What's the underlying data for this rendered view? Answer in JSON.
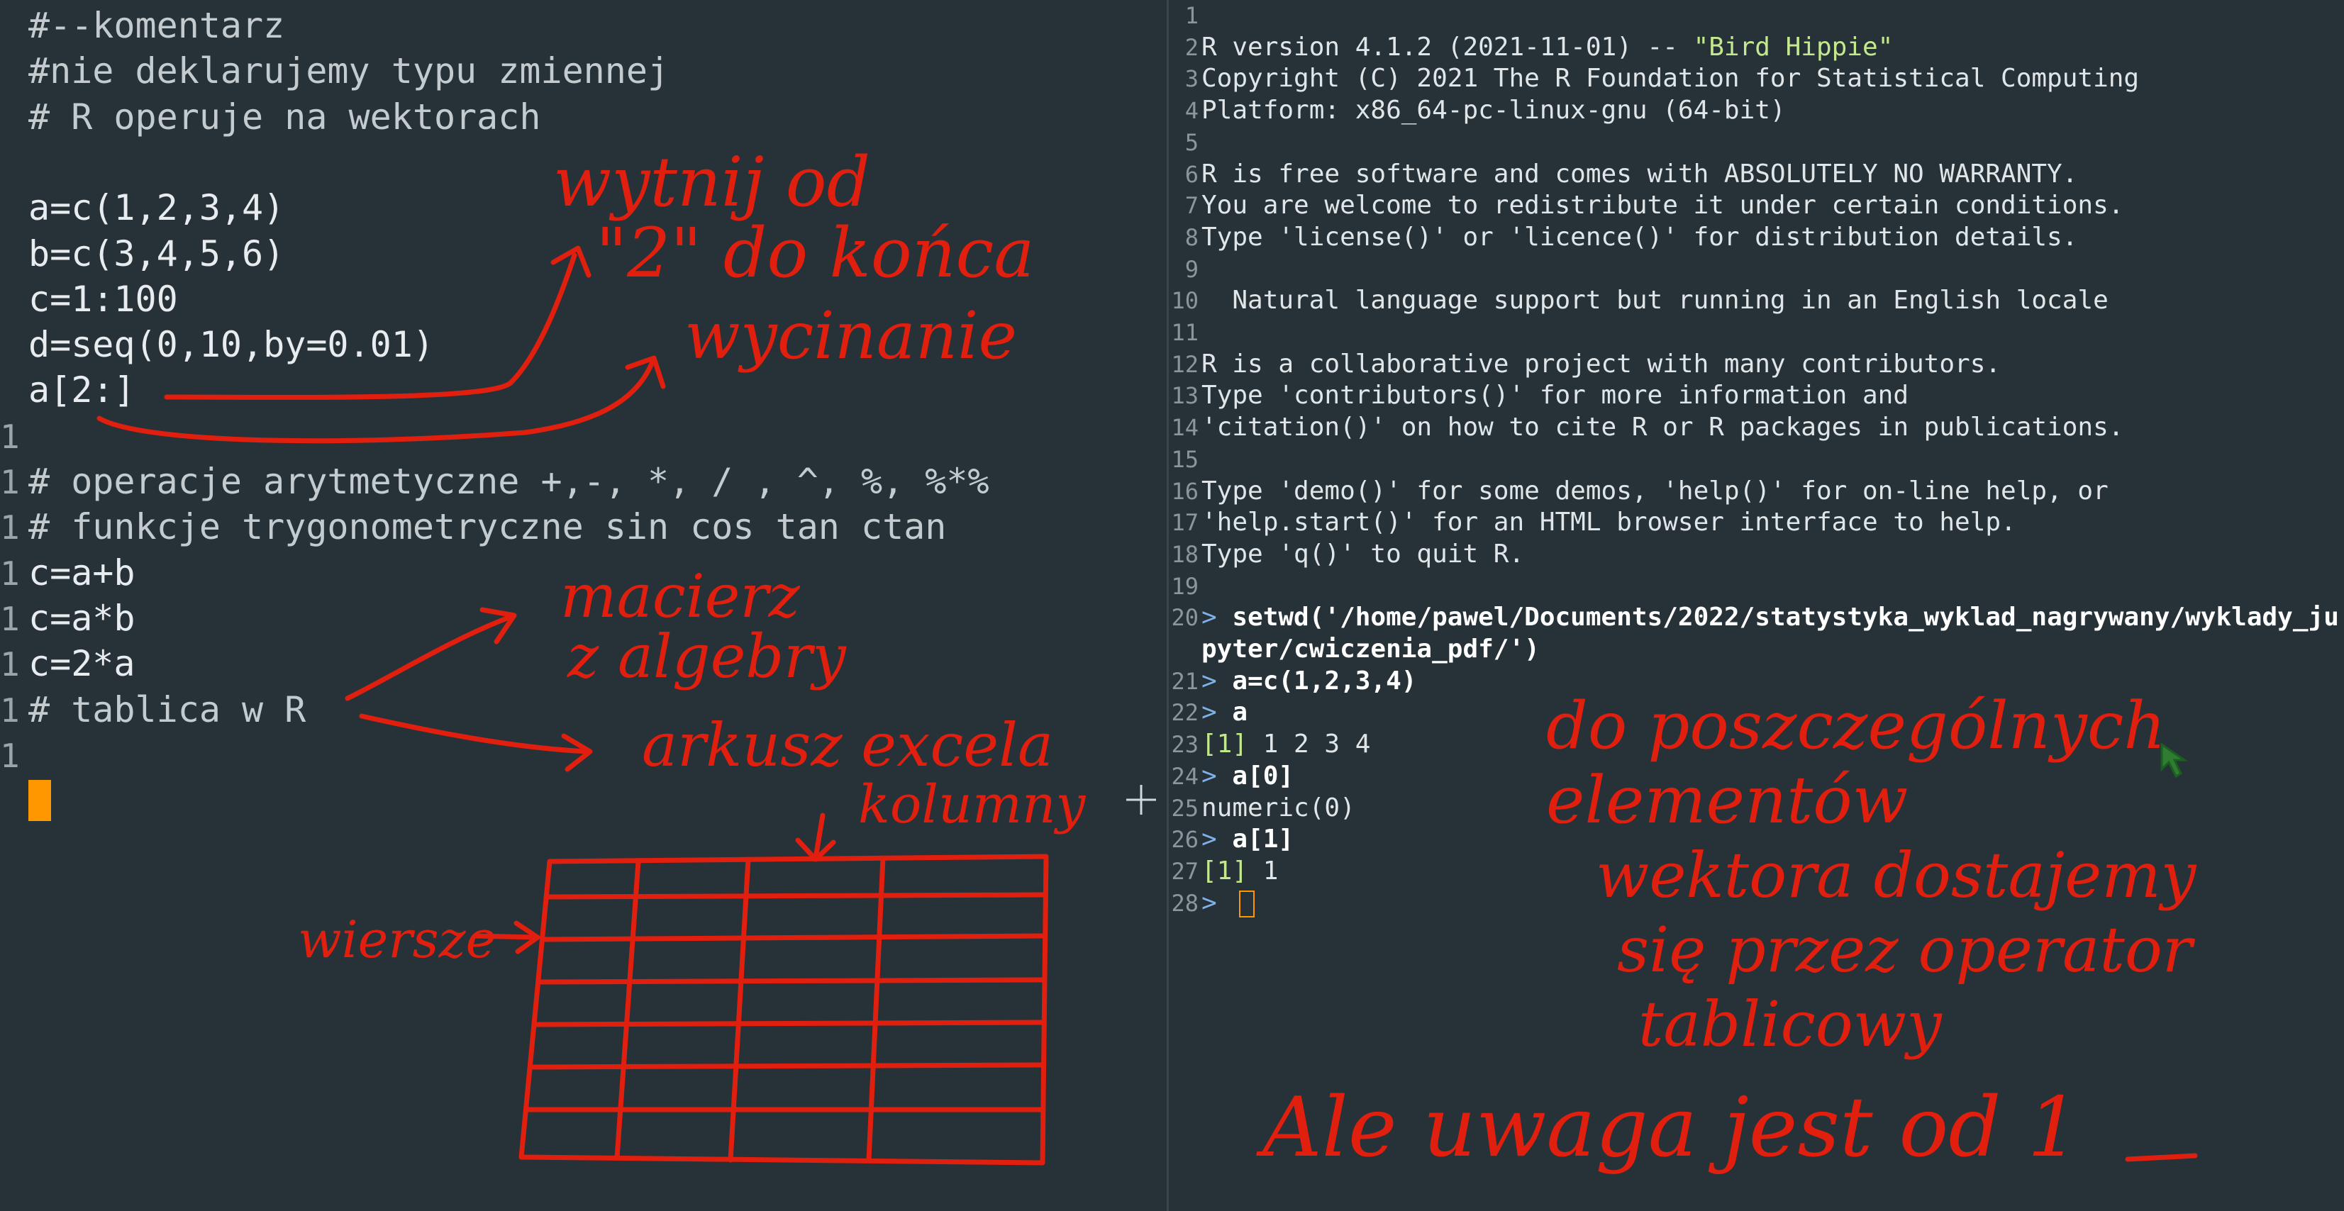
{
  "editor": {
    "lines": [
      {
        "gutter": "",
        "text": "#--komentarz",
        "comment": true
      },
      {
        "gutter": "",
        "text": "#nie deklarujemy typu zmiennej",
        "comment": true
      },
      {
        "gutter": "",
        "text": "# R operuje na wektorach",
        "comment": true
      },
      {
        "gutter": "",
        "text": "",
        "comment": false
      },
      {
        "gutter": "",
        "text": "a=c(1,2,3,4)",
        "comment": false
      },
      {
        "gutter": "",
        "text": "b=c(3,4,5,6)",
        "comment": false
      },
      {
        "gutter": "",
        "text": "c=1:100",
        "comment": false
      },
      {
        "gutter": "",
        "text": "d=seq(0,10,by=0.01)",
        "comment": false
      },
      {
        "gutter": "",
        "text": "a[2:]",
        "comment": false
      },
      {
        "gutter": "1",
        "text": "",
        "comment": false
      },
      {
        "gutter": "1",
        "text": "# operacje arytmetyczne +,-, *, / , ^, %, %*%",
        "comment": true
      },
      {
        "gutter": "1",
        "text": "# funkcje trygonometryczne sin cos tan ctan",
        "comment": true
      },
      {
        "gutter": "1",
        "text": "c=a+b",
        "comment": false
      },
      {
        "gutter": "1",
        "text": "c=a*b",
        "comment": false
      },
      {
        "gutter": "1",
        "text": "c=2*a",
        "comment": false
      },
      {
        "gutter": "1",
        "text": "# tablica w R",
        "comment": true
      },
      {
        "gutter": "1",
        "text": "",
        "comment": false
      }
    ]
  },
  "console": {
    "lines": [
      {
        "gutter": "1",
        "parts": [
          {
            "t": "",
            "c": ""
          }
        ]
      },
      {
        "gutter": "2",
        "parts": [
          {
            "t": "R version 4.1.2 (2021-11-01) -- ",
            "c": ""
          },
          {
            "t": "\"Bird Hippie\"",
            "c": "str"
          }
        ]
      },
      {
        "gutter": "3",
        "parts": [
          {
            "t": "Copyright (C) 2021 The R Foundation for Statistical Computing",
            "c": ""
          }
        ]
      },
      {
        "gutter": "4",
        "parts": [
          {
            "t": "Platform: x86_64-pc-linux-gnu (64-bit)",
            "c": ""
          }
        ]
      },
      {
        "gutter": "5",
        "parts": [
          {
            "t": "",
            "c": ""
          }
        ]
      },
      {
        "gutter": "6",
        "parts": [
          {
            "t": "R is free software and comes with ABSOLUTELY NO WARRANTY.",
            "c": ""
          }
        ]
      },
      {
        "gutter": "7",
        "parts": [
          {
            "t": "You are welcome to redistribute it under certain conditions.",
            "c": ""
          }
        ]
      },
      {
        "gutter": "8",
        "parts": [
          {
            "t": "Type 'license()' or 'licence()' for distribution details.",
            "c": ""
          }
        ]
      },
      {
        "gutter": "9",
        "parts": [
          {
            "t": "",
            "c": ""
          }
        ]
      },
      {
        "gutter": "10",
        "parts": [
          {
            "t": "  Natural language support but running in an English locale",
            "c": ""
          }
        ]
      },
      {
        "gutter": "11",
        "parts": [
          {
            "t": "",
            "c": ""
          }
        ]
      },
      {
        "gutter": "12",
        "parts": [
          {
            "t": "R is a collaborative project with many contributors.",
            "c": ""
          }
        ]
      },
      {
        "gutter": "13",
        "parts": [
          {
            "t": "Type 'contributors()' for more information and",
            "c": ""
          }
        ]
      },
      {
        "gutter": "14",
        "parts": [
          {
            "t": "'citation()' on how to cite R or R packages in publications.",
            "c": ""
          }
        ]
      },
      {
        "gutter": "15",
        "parts": [
          {
            "t": "",
            "c": ""
          }
        ]
      },
      {
        "gutter": "16",
        "parts": [
          {
            "t": "Type 'demo()' for some demos, 'help()' for on-line help, or",
            "c": ""
          }
        ]
      },
      {
        "gutter": "17",
        "parts": [
          {
            "t": "'help.start()' for an HTML browser interface to help.",
            "c": ""
          }
        ]
      },
      {
        "gutter": "18",
        "parts": [
          {
            "t": "Type 'q()' to quit R.",
            "c": ""
          }
        ]
      },
      {
        "gutter": "19",
        "parts": [
          {
            "t": "",
            "c": ""
          }
        ]
      },
      {
        "gutter": "20",
        "parts": [
          {
            "t": "> ",
            "c": "prompt"
          },
          {
            "t": "setwd('/home/pawel/Documents/2022/statystyka_wyklad_nagrywany/wyklady_ju",
            "c": "cmd"
          }
        ]
      },
      {
        "gutter": "",
        "parts": [
          {
            "t": "pyter/cwiczenia_pdf/')",
            "c": "cmd"
          }
        ]
      },
      {
        "gutter": "21",
        "parts": [
          {
            "t": "> ",
            "c": "prompt"
          },
          {
            "t": "a=c(1,2,3,4)",
            "c": "cmd"
          }
        ]
      },
      {
        "gutter": "22",
        "parts": [
          {
            "t": "> ",
            "c": "prompt"
          },
          {
            "t": "a",
            "c": "cmd"
          }
        ]
      },
      {
        "gutter": "23",
        "parts": [
          {
            "t": "[1]",
            "c": "idx"
          },
          {
            "t": " 1 2 3 4",
            "c": ""
          }
        ]
      },
      {
        "gutter": "24",
        "parts": [
          {
            "t": "> ",
            "c": "prompt"
          },
          {
            "t": "a[0]",
            "c": "cmd"
          }
        ]
      },
      {
        "gutter": "25",
        "parts": [
          {
            "t": "numeric(0)",
            "c": ""
          }
        ]
      },
      {
        "gutter": "26",
        "parts": [
          {
            "t": "> ",
            "c": "prompt"
          },
          {
            "t": "a[1]",
            "c": "cmd"
          }
        ]
      },
      {
        "gutter": "27",
        "parts": [
          {
            "t": "[1]",
            "c": "idx"
          },
          {
            "t": " 1",
            "c": ""
          }
        ]
      },
      {
        "gutter": "28",
        "parts": [
          {
            "t": "> ",
            "c": "prompt"
          }
        ]
      }
    ]
  },
  "annotations": {
    "n1": "wytnij od",
    "n2": "\"2\" do końca",
    "n3": "wycinanie",
    "n4": "macierz",
    "n5": "z algebry",
    "n6": "arkusz excela",
    "n7": "kolumny",
    "n8": "wiersze",
    "n9": "do poszczególnych",
    "n10": "elementów",
    "n11": "wektora dostajemy",
    "n12": "się przez operator",
    "n13": "tablicowy",
    "n14": "Ale uwaga jest od 1",
    "ink_color": "#e11f0f"
  },
  "theme": {
    "background": "#263238",
    "cursor": "#ff9800"
  }
}
